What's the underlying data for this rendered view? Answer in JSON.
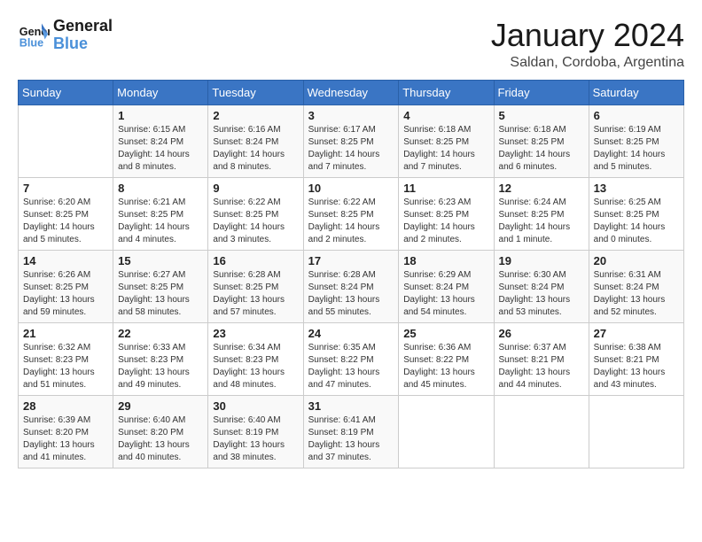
{
  "logo": {
    "line1": "General",
    "line2": "Blue"
  },
  "title": "January 2024",
  "subtitle": "Saldan, Cordoba, Argentina",
  "days_of_week": [
    "Sunday",
    "Monday",
    "Tuesday",
    "Wednesday",
    "Thursday",
    "Friday",
    "Saturday"
  ],
  "weeks": [
    [
      {
        "num": "",
        "info": ""
      },
      {
        "num": "1",
        "info": "Sunrise: 6:15 AM\nSunset: 8:24 PM\nDaylight: 14 hours\nand 8 minutes."
      },
      {
        "num": "2",
        "info": "Sunrise: 6:16 AM\nSunset: 8:24 PM\nDaylight: 14 hours\nand 8 minutes."
      },
      {
        "num": "3",
        "info": "Sunrise: 6:17 AM\nSunset: 8:25 PM\nDaylight: 14 hours\nand 7 minutes."
      },
      {
        "num": "4",
        "info": "Sunrise: 6:18 AM\nSunset: 8:25 PM\nDaylight: 14 hours\nand 7 minutes."
      },
      {
        "num": "5",
        "info": "Sunrise: 6:18 AM\nSunset: 8:25 PM\nDaylight: 14 hours\nand 6 minutes."
      },
      {
        "num": "6",
        "info": "Sunrise: 6:19 AM\nSunset: 8:25 PM\nDaylight: 14 hours\nand 5 minutes."
      }
    ],
    [
      {
        "num": "7",
        "info": "Sunrise: 6:20 AM\nSunset: 8:25 PM\nDaylight: 14 hours\nand 5 minutes."
      },
      {
        "num": "8",
        "info": "Sunrise: 6:21 AM\nSunset: 8:25 PM\nDaylight: 14 hours\nand 4 minutes."
      },
      {
        "num": "9",
        "info": "Sunrise: 6:22 AM\nSunset: 8:25 PM\nDaylight: 14 hours\nand 3 minutes."
      },
      {
        "num": "10",
        "info": "Sunrise: 6:22 AM\nSunset: 8:25 PM\nDaylight: 14 hours\nand 2 minutes."
      },
      {
        "num": "11",
        "info": "Sunrise: 6:23 AM\nSunset: 8:25 PM\nDaylight: 14 hours\nand 2 minutes."
      },
      {
        "num": "12",
        "info": "Sunrise: 6:24 AM\nSunset: 8:25 PM\nDaylight: 14 hours\nand 1 minute."
      },
      {
        "num": "13",
        "info": "Sunrise: 6:25 AM\nSunset: 8:25 PM\nDaylight: 14 hours\nand 0 minutes."
      }
    ],
    [
      {
        "num": "14",
        "info": "Sunrise: 6:26 AM\nSunset: 8:25 PM\nDaylight: 13 hours\nand 59 minutes."
      },
      {
        "num": "15",
        "info": "Sunrise: 6:27 AM\nSunset: 8:25 PM\nDaylight: 13 hours\nand 58 minutes."
      },
      {
        "num": "16",
        "info": "Sunrise: 6:28 AM\nSunset: 8:25 PM\nDaylight: 13 hours\nand 57 minutes."
      },
      {
        "num": "17",
        "info": "Sunrise: 6:28 AM\nSunset: 8:24 PM\nDaylight: 13 hours\nand 55 minutes."
      },
      {
        "num": "18",
        "info": "Sunrise: 6:29 AM\nSunset: 8:24 PM\nDaylight: 13 hours\nand 54 minutes."
      },
      {
        "num": "19",
        "info": "Sunrise: 6:30 AM\nSunset: 8:24 PM\nDaylight: 13 hours\nand 53 minutes."
      },
      {
        "num": "20",
        "info": "Sunrise: 6:31 AM\nSunset: 8:24 PM\nDaylight: 13 hours\nand 52 minutes."
      }
    ],
    [
      {
        "num": "21",
        "info": "Sunrise: 6:32 AM\nSunset: 8:23 PM\nDaylight: 13 hours\nand 51 minutes."
      },
      {
        "num": "22",
        "info": "Sunrise: 6:33 AM\nSunset: 8:23 PM\nDaylight: 13 hours\nand 49 minutes."
      },
      {
        "num": "23",
        "info": "Sunrise: 6:34 AM\nSunset: 8:23 PM\nDaylight: 13 hours\nand 48 minutes."
      },
      {
        "num": "24",
        "info": "Sunrise: 6:35 AM\nSunset: 8:22 PM\nDaylight: 13 hours\nand 47 minutes."
      },
      {
        "num": "25",
        "info": "Sunrise: 6:36 AM\nSunset: 8:22 PM\nDaylight: 13 hours\nand 45 minutes."
      },
      {
        "num": "26",
        "info": "Sunrise: 6:37 AM\nSunset: 8:21 PM\nDaylight: 13 hours\nand 44 minutes."
      },
      {
        "num": "27",
        "info": "Sunrise: 6:38 AM\nSunset: 8:21 PM\nDaylight: 13 hours\nand 43 minutes."
      }
    ],
    [
      {
        "num": "28",
        "info": "Sunrise: 6:39 AM\nSunset: 8:20 PM\nDaylight: 13 hours\nand 41 minutes."
      },
      {
        "num": "29",
        "info": "Sunrise: 6:40 AM\nSunset: 8:20 PM\nDaylight: 13 hours\nand 40 minutes."
      },
      {
        "num": "30",
        "info": "Sunrise: 6:40 AM\nSunset: 8:19 PM\nDaylight: 13 hours\nand 38 minutes."
      },
      {
        "num": "31",
        "info": "Sunrise: 6:41 AM\nSunset: 8:19 PM\nDaylight: 13 hours\nand 37 minutes."
      },
      {
        "num": "",
        "info": ""
      },
      {
        "num": "",
        "info": ""
      },
      {
        "num": "",
        "info": ""
      }
    ]
  ]
}
